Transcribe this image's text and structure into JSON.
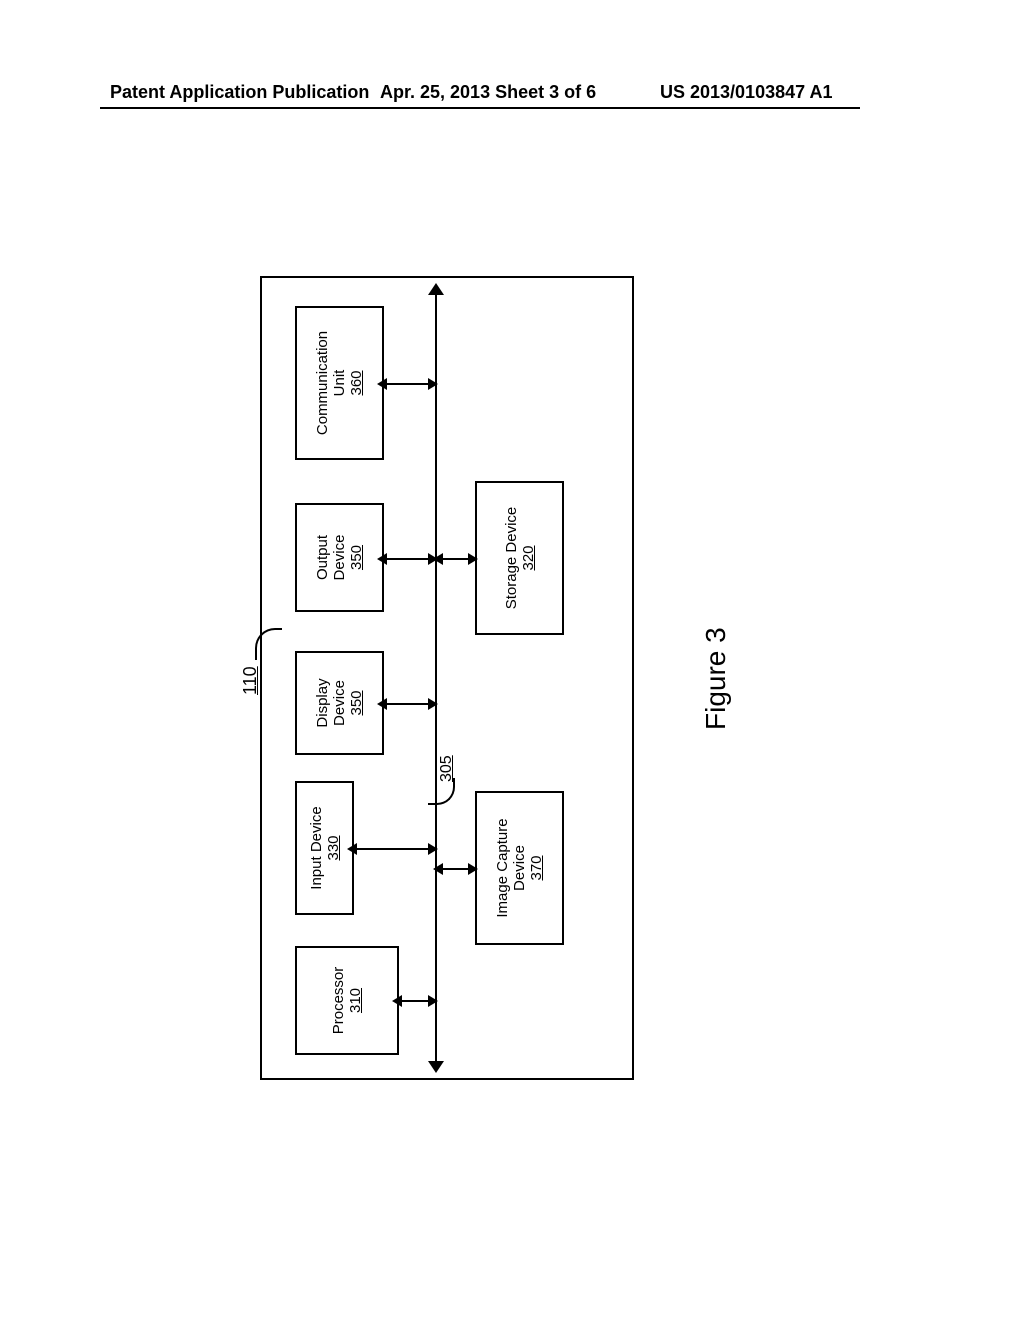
{
  "header": {
    "left": "Patent Application Publication",
    "middle": "Apr. 25, 2013  Sheet 3 of 6",
    "right": "US 2013/0103847 A1"
  },
  "figure_label": "Figure 3",
  "ref_outer": "110",
  "ref_bus": "305",
  "blocks": {
    "processor": {
      "label": "Processor",
      "ref": "310"
    },
    "input": {
      "label": "Input Device",
      "ref": "330"
    },
    "display": {
      "label_l1": "Display",
      "label_l2": "Device",
      "ref": "350"
    },
    "output": {
      "label_l1": "Output",
      "label_l2": "Device",
      "ref": "350"
    },
    "comm": {
      "label_l1": "Communication",
      "label_l2": "Unit",
      "ref": "360"
    },
    "imgcap": {
      "label_l1": "Image Capture",
      "label_l2": "Device",
      "ref": "370"
    },
    "storage": {
      "label": "Storage Device",
      "ref": "320"
    }
  }
}
